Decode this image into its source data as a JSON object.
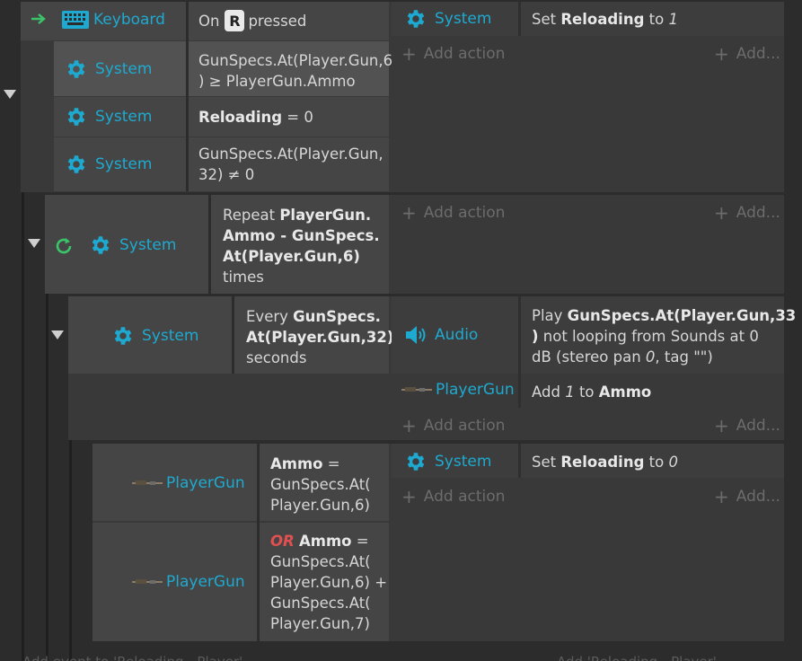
{
  "events": {
    "e1": {
      "trigger_object": "Keyboard",
      "trigger_text_pre": "On",
      "trigger_key": "R",
      "trigger_text_post": "pressed",
      "conditions": [
        {
          "object": "System",
          "text1": "GunSpecs.At(Player.Gun,6",
          "text2": ") ≥ PlayerGun.Ammo"
        },
        {
          "object": "System",
          "bold": "Reloading",
          "text": " = 0"
        },
        {
          "object": "System",
          "text1": "GunSpecs.At(Player.Gun,",
          "text2": "32) ≠ 0"
        }
      ],
      "action_object": "System",
      "action_pre": "Set ",
      "action_bold": "Reloading",
      "action_mid": " to ",
      "action_val": "1"
    },
    "e2": {
      "object": "System",
      "lines": [
        {
          "pre": "Repeat ",
          "bold": "PlayerGun."
        },
        {
          "pre": "",
          "bold": "Ammo - GunSpecs."
        },
        {
          "pre": "",
          "bold": "At(Player.Gun,6)"
        },
        {
          "pre": "times",
          "bold": ""
        }
      ]
    },
    "e3": {
      "object": "System",
      "lines": [
        {
          "pre": "Every ",
          "bold": "GunSpecs."
        },
        {
          "pre": "",
          "bold": "At(Player.Gun,32)"
        },
        {
          "pre": "seconds",
          "bold": ""
        }
      ],
      "action1_object": "Audio",
      "action1_lines": [
        {
          "pre": "Play ",
          "bold": "GunSpecs.At(Player.Gun,33"
        },
        {
          "pre": "",
          "bold": ")",
          "post": " not looping from Sounds at 0"
        },
        {
          "pre": "dB (stereo pan ",
          "ital": "0",
          "post": ", tag \"\")"
        }
      ],
      "action2_object": "PlayerGun",
      "action2_pre": "Add ",
      "action2_val": "1",
      "action2_mid": " to ",
      "action2_bold": "Ammo"
    },
    "e4": {
      "cond1_object": "PlayerGun",
      "cond1_lines": [
        {
          "bold": "Ammo",
          "post": " ="
        },
        {
          "post": "GunSpecs.At("
        },
        {
          "post": "Player.Gun,6)"
        }
      ],
      "or_label": "OR",
      "cond2_object": "PlayerGun",
      "cond2_lines": [
        {
          "bold": "Ammo",
          "post": " ="
        },
        {
          "post": "GunSpecs.At("
        },
        {
          "post": "Player.Gun,6) +"
        },
        {
          "post": "GunSpecs.At("
        },
        {
          "post": "Player.Gun,7)"
        }
      ],
      "action_object": "System",
      "action_pre": "Set ",
      "action_bold": "Reloading",
      "action_mid": " to ",
      "action_val": "0"
    }
  },
  "add_action_label": "Add action",
  "add_short_label": "Add...",
  "bottom_left": "Add event to 'Reloading - Player'",
  "bottom_right": "Add 'Reloading - Player'",
  "colors": {
    "object": "#1eaad0",
    "or": "#e05050",
    "trigger_arrow": "#3cc46a",
    "repeat_icon": "#3cc46a"
  }
}
